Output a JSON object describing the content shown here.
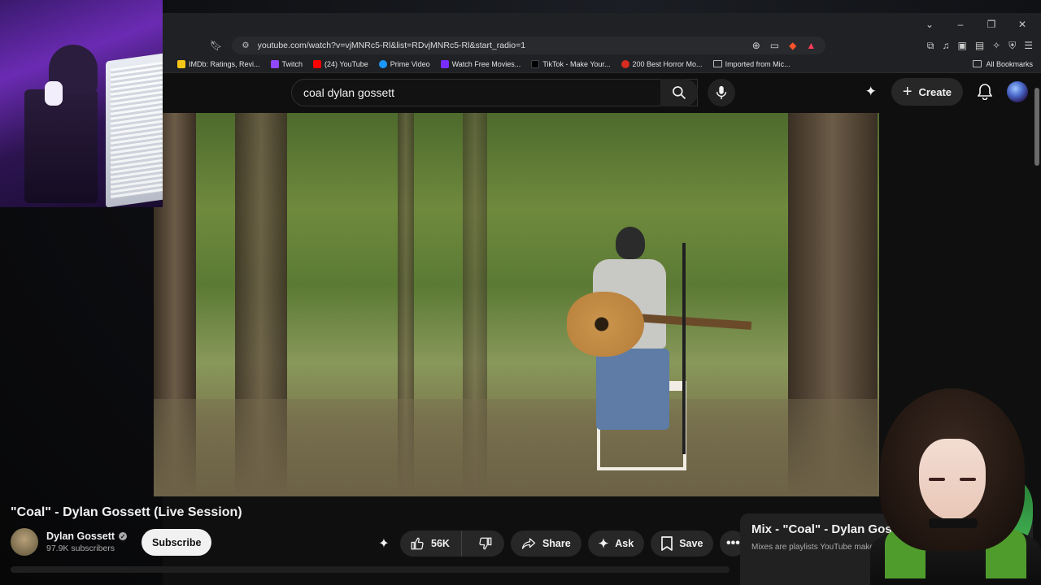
{
  "browser": {
    "url": "youtube.com/watch?v=vjMNRc5-Rl&list=RDvjMNRc5-Rl&start_radio=1",
    "bookmarks": [
      {
        "label": "IMDb: Ratings, Revi...",
        "color": "#f5c518"
      },
      {
        "label": "Twitch",
        "color": "#9146ff"
      },
      {
        "label": "(24) YouTube",
        "color": "#ff0000"
      },
      {
        "label": "Prime Video",
        "color": "#1a98ff"
      },
      {
        "label": "Watch Free Movies...",
        "color": "#7b2cff"
      },
      {
        "label": "TikTok - Make Your...",
        "color": "#000000"
      },
      {
        "label": "200 Best Horror Mo...",
        "color": "#d62d20"
      }
    ],
    "bookmark_folder": "Imported from Mic...",
    "all_bookmarks": "All Bookmarks"
  },
  "youtube": {
    "search_query": "coal dylan gossett",
    "create_label": "Create",
    "video_title": "\"Coal\" - Dylan Gossett (Live Session)",
    "channel_name": "Dylan Gossett",
    "subscribers": "97.9K subscribers",
    "subscribe_label": "Subscribe",
    "likes": "56K",
    "share_label": "Share",
    "ask_label": "Ask",
    "save_label": "Save",
    "mix_title": "Mix - \"Coal\" - Dylan Gossett",
    "mix_subtitle": "Mixes are playlists YouTube makes for you"
  },
  "icons": {
    "window_controls": [
      "chevron-down-icon",
      "minimize-icon",
      "restore-icon",
      "close-icon"
    ],
    "accent": "#ff0000"
  }
}
